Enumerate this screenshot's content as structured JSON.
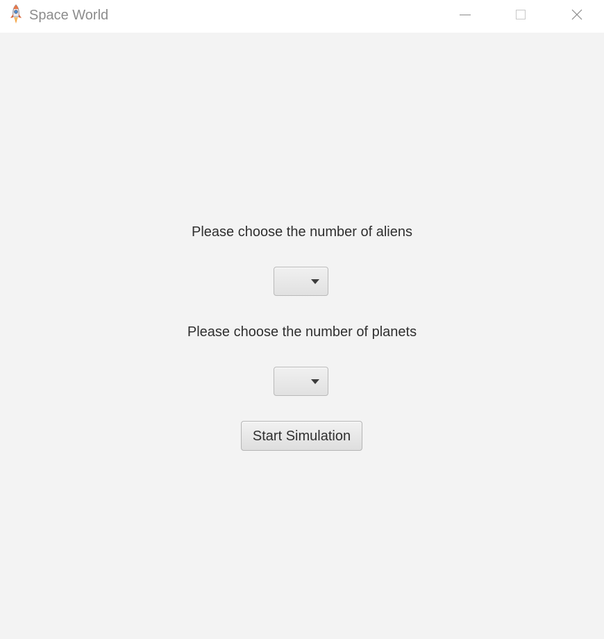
{
  "window": {
    "title": "Space World",
    "icon": "rocket-icon",
    "controls": [
      "minimize-icon",
      "maximize-icon",
      "close-icon"
    ]
  },
  "form": {
    "aliens_label": "Please choose the number of aliens",
    "aliens_value": "",
    "planets_label": "Please choose the number of planets",
    "planets_value": "",
    "start_button_label": "Start Simulation"
  },
  "colors": {
    "background": "#f3f3f3",
    "titlebar": "#ffffff",
    "title_text": "#8c8c8c",
    "text": "#2f2f2f"
  }
}
